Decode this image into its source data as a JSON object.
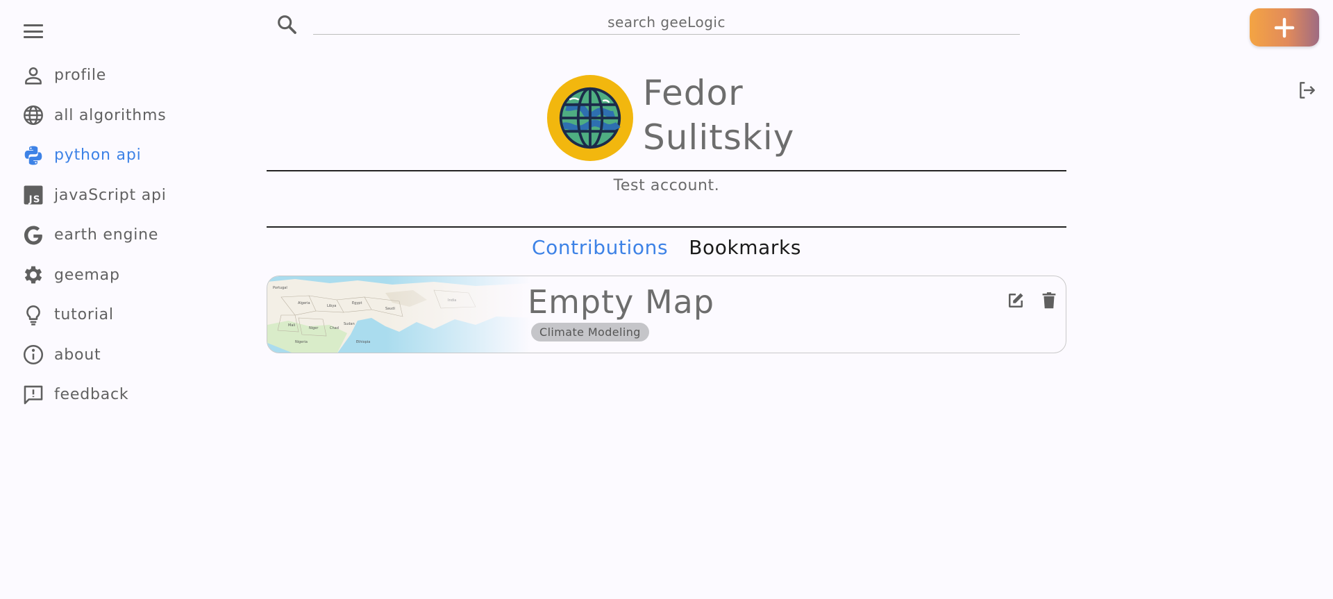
{
  "search": {
    "placeholder": "search geeLogic"
  },
  "sidebar": {
    "items": [
      {
        "label": "profile",
        "icon": "person-icon",
        "active": false
      },
      {
        "label": "all algorithms",
        "icon": "globe-icon",
        "active": false
      },
      {
        "label": "python api",
        "icon": "python-icon",
        "active": true
      },
      {
        "label": "javaScript api",
        "icon": "javascript-icon",
        "active": false
      },
      {
        "label": "earth engine",
        "icon": "google-g-icon",
        "active": false
      },
      {
        "label": "geemap",
        "icon": "gear-icon",
        "active": false
      },
      {
        "label": "tutorial",
        "icon": "lightbulb-icon",
        "active": false
      },
      {
        "label": "about",
        "icon": "info-icon",
        "active": false
      },
      {
        "label": "feedback",
        "icon": "feedback-icon",
        "active": false
      }
    ]
  },
  "profile": {
    "first_name": "Fedor",
    "last_name": "Sulitskiy",
    "bio": "Test account."
  },
  "tabs": [
    {
      "label": "Contributions",
      "active": true
    },
    {
      "label": "Bookmarks",
      "active": false
    }
  ],
  "contributions": [
    {
      "title": "Empty Map",
      "tag": "Climate Modeling"
    }
  ],
  "colors": {
    "accent": "#3d82e6",
    "background": "#fcfaff",
    "avatar_ring": "#f2b70e",
    "add_button_gradient": [
      "#f4a443",
      "#9e6b82"
    ]
  }
}
